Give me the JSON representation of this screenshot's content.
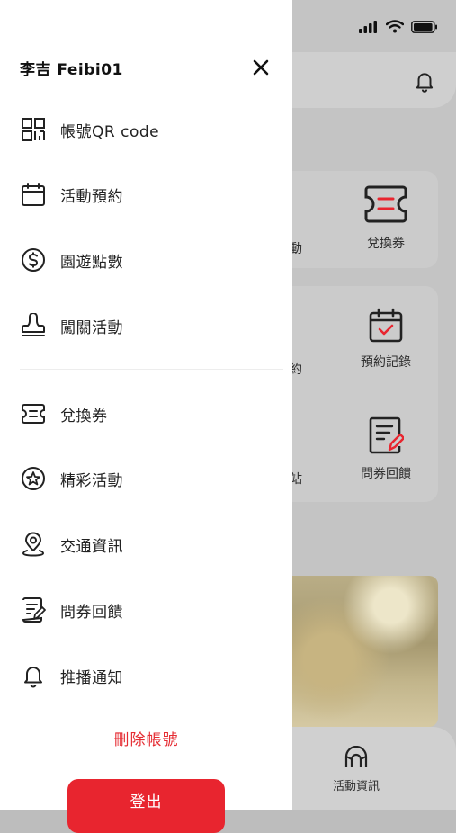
{
  "drawer": {
    "user_name": "李吉  Feibi01",
    "menu_group1": [
      {
        "label": "帳號QR code",
        "icon": "qr-code-icon"
      },
      {
        "label": "活動預約",
        "icon": "calendar-icon"
      },
      {
        "label": "園遊點數",
        "icon": "dollar-coin-icon"
      },
      {
        "label": "闖關活動",
        "icon": "stamp-icon"
      }
    ],
    "menu_group2": [
      {
        "label": "兌換券",
        "icon": "ticket-icon"
      },
      {
        "label": "精彩活動",
        "icon": "star-badge-icon"
      },
      {
        "label": "交通資訊",
        "icon": "location-pin-icon"
      },
      {
        "label": "問券回饋",
        "icon": "survey-icon"
      },
      {
        "label": "推播通知",
        "icon": "bell-icon"
      }
    ],
    "delete_account": "刪除帳號",
    "logout": "登出"
  },
  "background": {
    "row1": {
      "partial": "動",
      "item": "兌換券"
    },
    "row2": {
      "partial": "約",
      "item": "預約記錄"
    },
    "row3": {
      "partial": "站",
      "item": "問券回饋"
    },
    "tab": "活動資訊"
  },
  "colors": {
    "accent": "#e8252f",
    "text": "#222222",
    "overlay_bg": "#c4c4c4"
  }
}
